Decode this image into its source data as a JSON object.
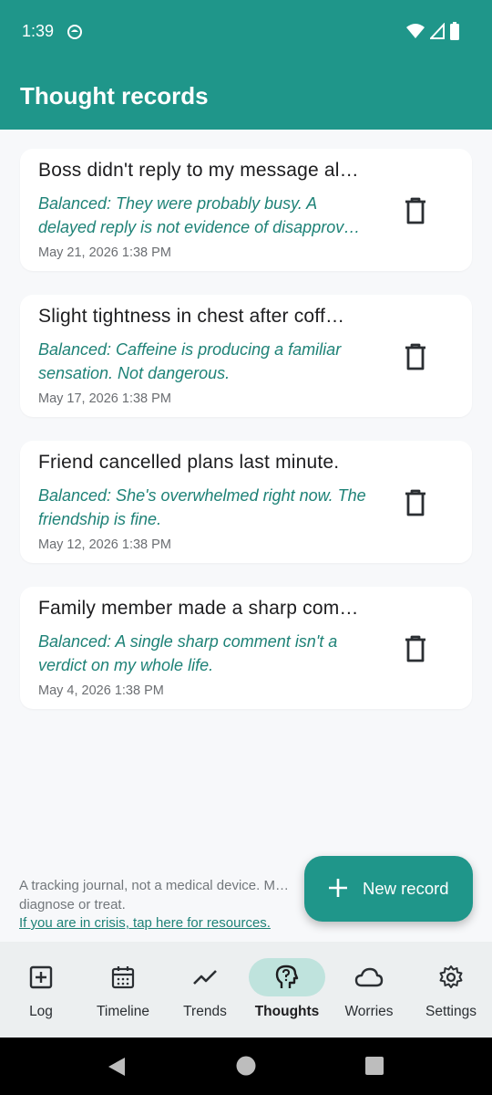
{
  "status_bar": {
    "time": "1:39"
  },
  "app_bar": {
    "title": "Thought records"
  },
  "records": [
    {
      "title": "Boss didn't reply to my message al…",
      "balanced": "Balanced: They were probably busy. A delayed reply is not evidence of disapprov…",
      "date": "May 21, 2026 1:38 PM"
    },
    {
      "title": "Slight tightness in chest after coff…",
      "balanced": "Balanced: Caffeine is producing a familiar sensation. Not dangerous.",
      "date": "May 17, 2026 1:38 PM"
    },
    {
      "title": "Friend cancelled plans last minute.",
      "balanced": "Balanced: She's overwhelmed right now. The friendship is fine.",
      "date": "May 12, 2026 1:38 PM"
    },
    {
      "title": "Family member made a sharp com…",
      "balanced": "Balanced: A single sharp comment isn't a verdict on my whole life.",
      "date": "May 4, 2026 1:38 PM"
    }
  ],
  "footer": {
    "disclaimer": "A tracking journal, not a medical device. M… diagnose or treat.",
    "crisis_link": "If you are in crisis, tap here for resources."
  },
  "fab": {
    "label": "New record",
    "icon": "plus-icon"
  },
  "nav": {
    "active": "Thoughts",
    "items": [
      {
        "label": "Log",
        "icon": "add-box-icon"
      },
      {
        "label": "Timeline",
        "icon": "calendar-icon"
      },
      {
        "label": "Trends",
        "icon": "trend-line-icon"
      },
      {
        "label": "Thoughts",
        "icon": "head-question-icon"
      },
      {
        "label": "Worries",
        "icon": "cloud-icon"
      },
      {
        "label": "Settings",
        "icon": "gear-icon"
      }
    ]
  },
  "colors": {
    "primary": "#1f968a",
    "accent_text": "#1e8277",
    "nav_active_bg": "#bfe3dd"
  }
}
